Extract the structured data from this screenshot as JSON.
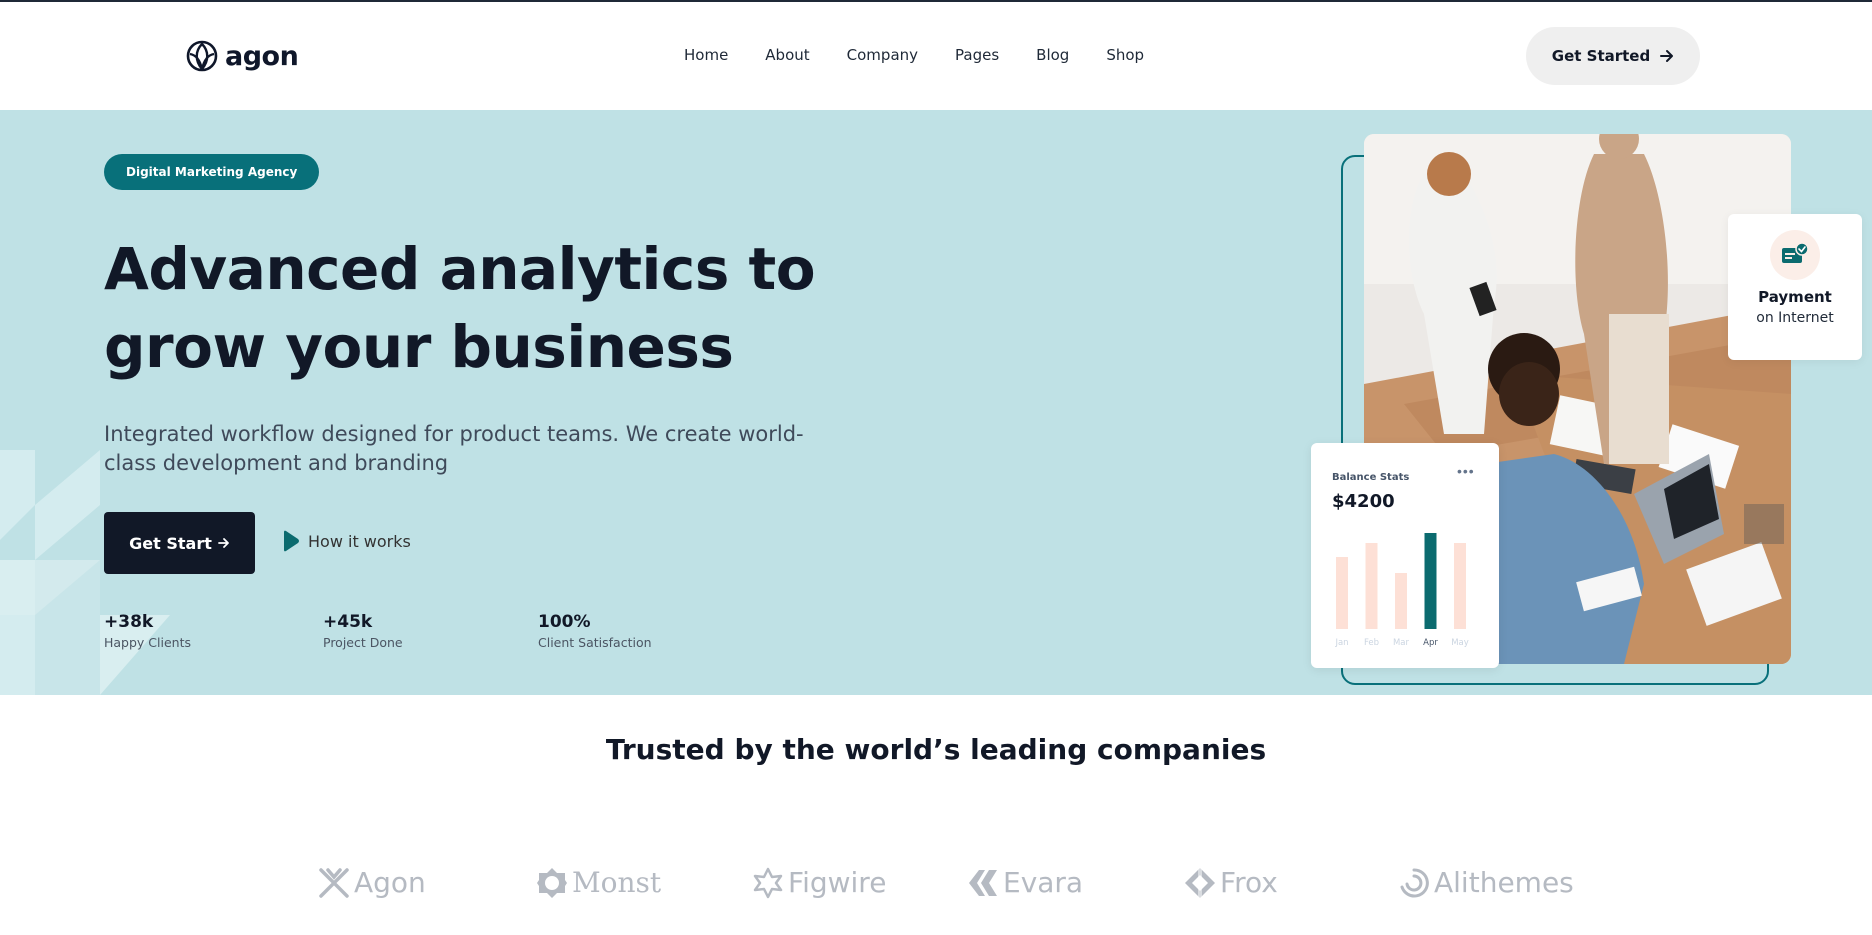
{
  "header": {
    "logo_text": "agon",
    "nav": [
      "Home",
      "About",
      "Company",
      "Pages",
      "Blog",
      "Shop"
    ],
    "cta_label": "Get Started"
  },
  "hero": {
    "badge": "Digital Marketing Agency",
    "headline_line1": "Advanced analytics to",
    "headline_line2": "grow your business",
    "subtitle_line1": "Integrated workflow designed for product teams. We create world-",
    "subtitle_line2": "class development and branding",
    "primary_button": "Get Start",
    "secondary_link": "How it works",
    "stats": [
      {
        "value": "+38k",
        "label": "Happy Clients"
      },
      {
        "value": "+45k",
        "label": "Project Done"
      },
      {
        "value": "100%",
        "label": "Client Satisfaction"
      }
    ]
  },
  "payment_card": {
    "title": "Payment",
    "subtitle": "on Internet"
  },
  "balance_card": {
    "title": "Balance Stats",
    "value": "$4200",
    "menu": "•••"
  },
  "chart_data": {
    "type": "bar",
    "title": "Balance Stats",
    "categories": [
      "Jan",
      "Feb",
      "Mar",
      "Apr",
      "May"
    ],
    "values": [
      72,
      86,
      56,
      96,
      86
    ],
    "highlight": "Apr",
    "colors": {
      "bar": "#fde0d6",
      "highlight": "#0b6b6f"
    }
  },
  "trusted": {
    "heading": "Trusted by the world’s leading companies",
    "brands": [
      "Agon",
      "Monst",
      "Figwire",
      "Evara",
      "Frox",
      "Alithemes"
    ]
  },
  "colors": {
    "hero_bg": "#bfe1e5",
    "accent": "#08707a",
    "dark": "#111827"
  }
}
